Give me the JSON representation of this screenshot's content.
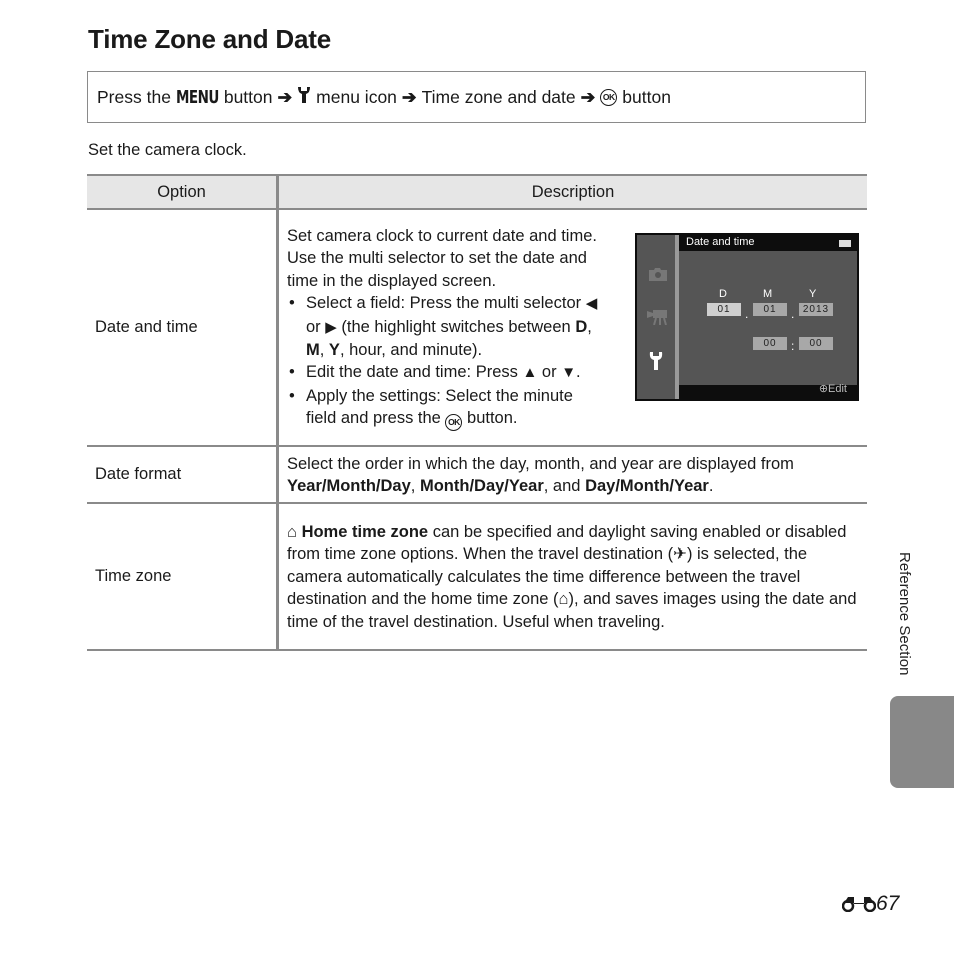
{
  "page": {
    "title": "Time Zone and Date",
    "intro": "Set the camera clock.",
    "side_section": "Reference Section",
    "page_prefix_icon": "binoculars-icon",
    "page_number": "67"
  },
  "nav_path": {
    "press": "Press the",
    "menu_button": "MENU",
    "button_word": "button",
    "menu_icon_label": "menu icon",
    "item": "Time zone and date",
    "ok_label": "OK",
    "final_word": "button"
  },
  "table": {
    "headers": [
      "Option",
      "Description"
    ],
    "rows": [
      {
        "option": "Date and time",
        "desc_line1": "Set camera clock to current date and time.",
        "desc_line2": "Use the multi selector to set the date and time in the displayed screen.",
        "bullets": {
          "b1_pre": "Select a field: Press the multi selector",
          "b1_or": "or",
          "b1_post": "(the highlight switches between",
          "b1_d": "D",
          "b1_m": "M",
          "b1_y": "Y",
          "b1_end": ", hour, and minute).",
          "b2_pre": "Edit the date and time: Press",
          "b2_or": "or",
          "b3_pre": "Apply the settings: Select the minute field and press the",
          "b3_post": "button."
        },
        "camera_screen": {
          "header": "Date and time",
          "labels": [
            "D",
            "M",
            "Y"
          ],
          "day": "01",
          "month": "01",
          "year": "2013",
          "hour": "00",
          "minute": "00",
          "date_separator": ".",
          "time_separator": ":",
          "footer": "Edit"
        }
      },
      {
        "option": "Date format",
        "desc_pre": "Select the order in which the day, month, and year are displayed from",
        "fmt1": "Year/Month/Day",
        "fmt2": "Month/Day/Year",
        "and": ", and",
        "fmt3": "Day/Month/Year"
      },
      {
        "option": "Time zone",
        "home_bold": "Home time zone",
        "p1": "can be specified and daylight saving enabled or disabled from time zone options. When the travel destination (",
        "p2": ") is selected, the camera automatically calculates the time difference between the travel destination and the home time zone (",
        "p3": "), and saves images using the date and time of the travel destination. Useful when traveling."
      }
    ]
  }
}
